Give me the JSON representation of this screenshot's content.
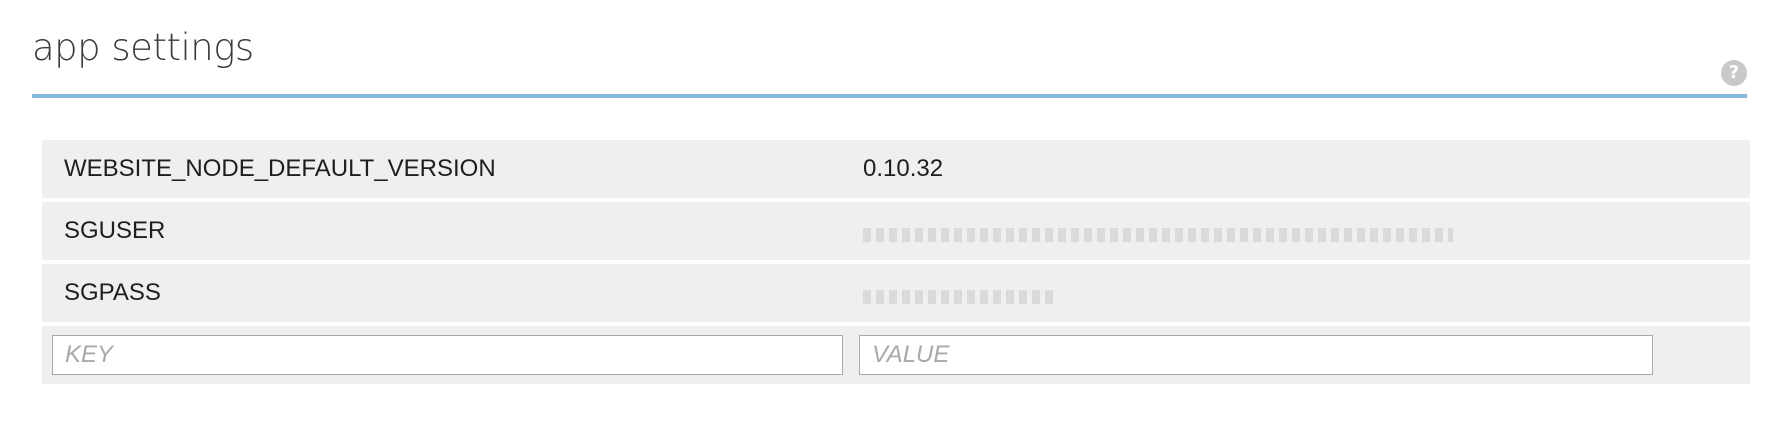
{
  "header": {
    "title": "app settings",
    "help_glyph": "?"
  },
  "settings": {
    "rows": [
      {
        "key": "WEBSITE_NODE_DEFAULT_VERSION",
        "value": "0.10.32"
      },
      {
        "key": "SGUSER",
        "value": "",
        "value_obscured": true
      },
      {
        "key": "SGPASS",
        "value": "",
        "value_obscured": true
      }
    ]
  },
  "new_setting": {
    "key_placeholder": "KEY",
    "value_placeholder": "VALUE"
  },
  "colors": {
    "header_rule": "#86b9e0",
    "row_background": "#efefef",
    "help_icon_bg": "#c9c9c9"
  },
  "icons": {
    "help": "help-icon"
  }
}
